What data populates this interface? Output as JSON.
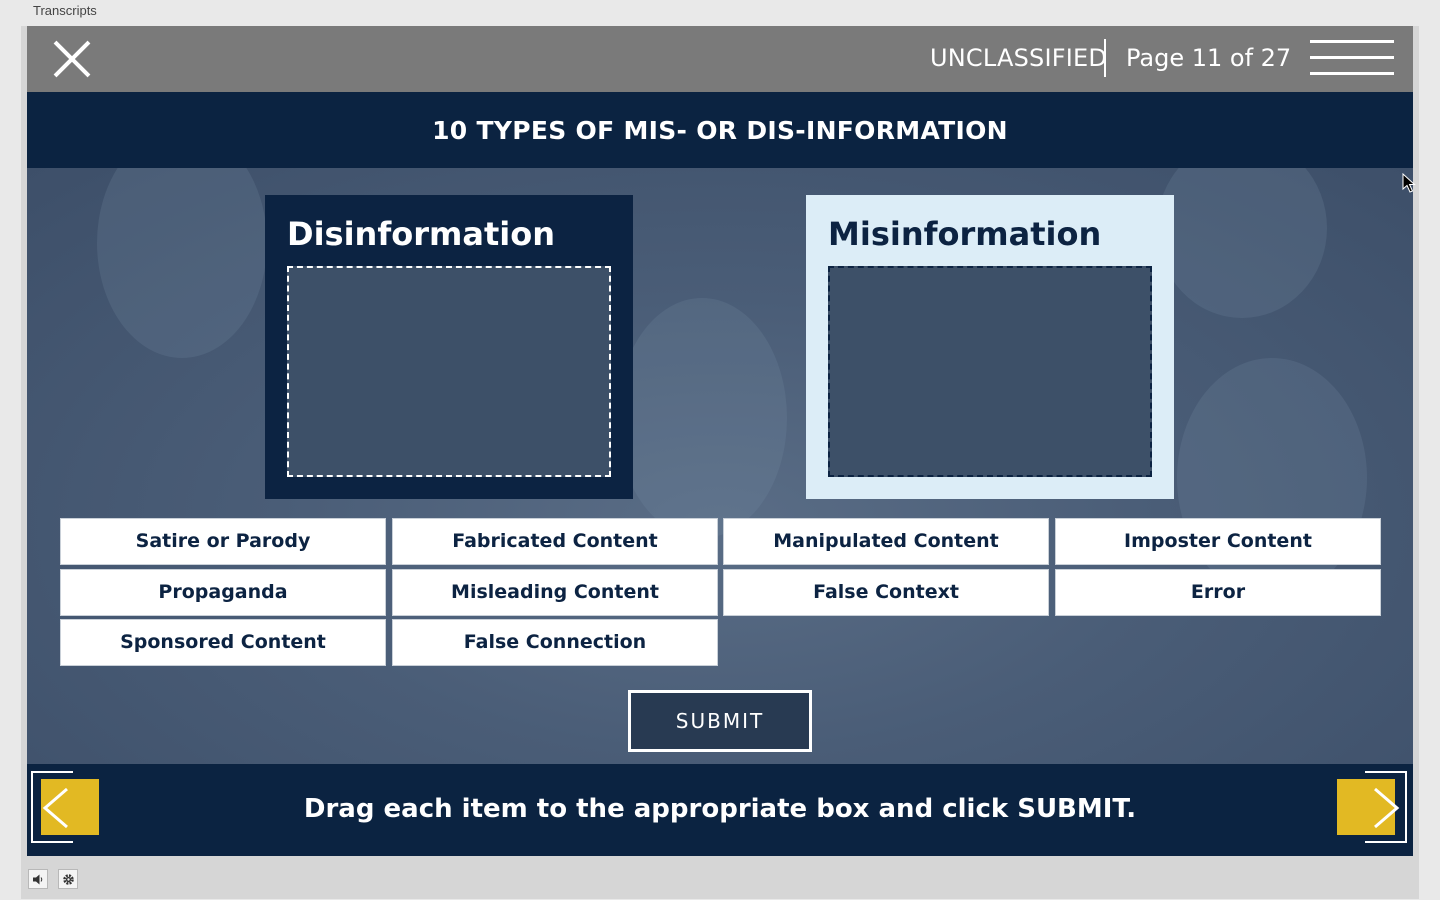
{
  "window": {
    "transcripts_label": "Transcripts"
  },
  "header": {
    "classification": "UNCLASSIFIED",
    "page_counter": "Page 11 of 27",
    "close_icon": "close-icon",
    "menu_icon": "hamburger-menu-icon"
  },
  "title": "10 TYPES OF MIS- OR DIS-INFORMATION",
  "drop_panels": [
    {
      "label": "Disinformation"
    },
    {
      "label": "Misinformation"
    }
  ],
  "drag_items": [
    "Satire or Parody",
    "Fabricated Content",
    "Manipulated Content",
    "Imposter Content",
    "Propaganda",
    "Misleading Content",
    "False Context",
    "Error",
    "Sponsored Content",
    "False Connection"
  ],
  "submit_label": "SUBMIT",
  "instruction": "Drag each item to the appropriate box and click SUBMIT.",
  "footer": {
    "volume_icon": "volume-icon",
    "settings_icon": "gear-icon"
  },
  "colors": {
    "navy": "#0b2341",
    "accent_yellow": "#e2b923",
    "light_panel": "#dcedf7",
    "topbar_gray": "#7a7a7a"
  }
}
